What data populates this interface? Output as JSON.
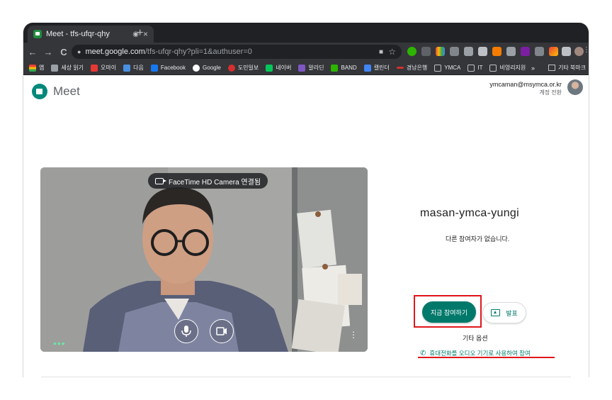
{
  "tab": {
    "title": "Meet - tfs-ufqr-qhy",
    "record_icon": "◉",
    "close": "×",
    "new_tab": "+"
  },
  "nav": {
    "back": "←",
    "forward": "→",
    "reload": "C"
  },
  "address": {
    "host": "meet.google.com",
    "path": "/tfs-ufqr-qhy?pli=1&authuser=0"
  },
  "bookmarks": [
    {
      "label": "앱",
      "color": "#ea4335"
    },
    {
      "label": "세상 읽기",
      "color": "#9aa0a6"
    },
    {
      "label": "오마이",
      "color": "#e53935"
    },
    {
      "label": "다음",
      "color": "#4a90e2"
    },
    {
      "label": "Facebook",
      "color": "#1877f2"
    },
    {
      "label": "Google",
      "color": "#ffffff"
    },
    {
      "label": "도민일보",
      "color": "#d32f2f"
    },
    {
      "label": "네이버",
      "color": "#03c75a"
    },
    {
      "label": "알라딘",
      "color": "#7e57c2"
    },
    {
      "label": "BAND",
      "color": "#2db400"
    },
    {
      "label": "캘린더",
      "color": "#4285f4"
    },
    {
      "label": "경남은행",
      "color": "#d32f2f"
    },
    {
      "label": "YMCA",
      "color": "#bdc1c6"
    },
    {
      "label": "IT",
      "color": "#bdc1c6"
    },
    {
      "label": "비영리지원",
      "color": "#bdc1c6"
    }
  ],
  "bookmarks_more": "»",
  "bookmarks_other": "기타 북마크",
  "app": {
    "name": "Meet",
    "brand_color": "#00796b"
  },
  "account": {
    "email": "ymcaman@msymca.or.kr",
    "switch": "계정 전환"
  },
  "preview": {
    "camera_label": "FaceTime HD Camera 연결됨",
    "mic_icon": "microphone-icon",
    "cam_icon": "camera-icon"
  },
  "meeting": {
    "room_name": "masan-ymca-yungi",
    "status": "다른 참여자가 없습니다.",
    "join_label": "지금 참여하기",
    "present_label": "발표",
    "other_options": "기타 옵션",
    "phone_audio": "휴대전화를 오디오 기기로 사용하여 참여"
  },
  "highlight_color": "#e0161b"
}
